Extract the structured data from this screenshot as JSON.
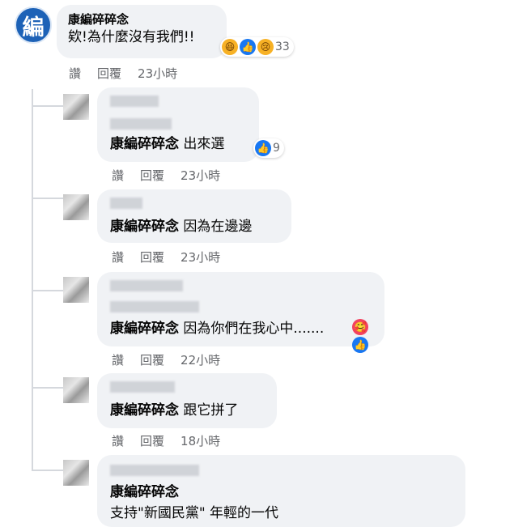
{
  "main": {
    "author": "康編碎碎念",
    "text": "欸!為什麼沒有我們!!",
    "reaction_count": "33",
    "actions": {
      "like": "讚",
      "reply": "回覆",
      "time": "23小時"
    }
  },
  "replies": [
    {
      "mention": "康編碎碎念",
      "text": "出來選",
      "reaction_count": "9",
      "time": "23小時"
    },
    {
      "mention": "康編碎碎念",
      "text": "因為在邊邊",
      "time": "23小時"
    },
    {
      "mention": "康編碎碎念",
      "text": "因為你們在我心中.......",
      "time": "22小時"
    },
    {
      "mention": "康編碎碎念",
      "text": "跟它拼了",
      "time": "18小時"
    },
    {
      "mention": "康編碎碎念",
      "text": "支持\"新國民黨\" 年輕的一代"
    }
  ],
  "labels": {
    "like": "讚",
    "reply": "回覆"
  },
  "icons": {
    "main_avatar": "編",
    "like_icon": "👍",
    "haha_icon": "😆",
    "sad_icon": "😢",
    "love_icon": "🥰"
  }
}
